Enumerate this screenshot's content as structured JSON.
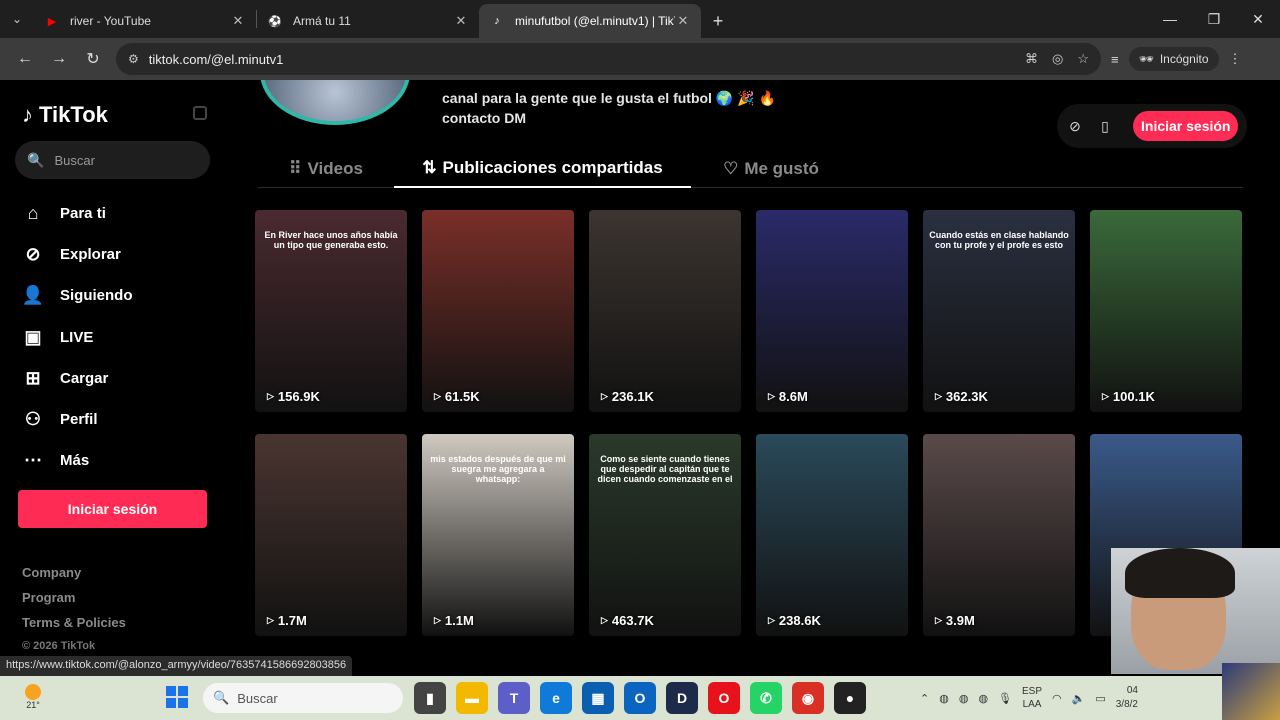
{
  "browser": {
    "tabs": [
      {
        "title": "river - YouTube",
        "favicon": "youtube-icon",
        "active": false
      },
      {
        "title": "Armá tu 11",
        "favicon": "soccer-ball-icon",
        "active": false
      },
      {
        "title": "minufutbol (@el.minutv1) | TikT",
        "favicon": "tiktok-icon",
        "active": true
      }
    ],
    "url": "tiktok.com/@el.minutv1",
    "incognito_label": "Incógnito",
    "status_url": "https://www.tiktok.com/@alonzo_armyy/video/7635741586692803856"
  },
  "sidebar": {
    "logo": "TikTok",
    "search_placeholder": "Buscar",
    "items": [
      {
        "label": "Para ti",
        "icon": "home-icon"
      },
      {
        "label": "Explorar",
        "icon": "compass-icon"
      },
      {
        "label": "Siguiendo",
        "icon": "following-icon"
      },
      {
        "label": "LIVE",
        "icon": "live-icon"
      },
      {
        "label": "Cargar",
        "icon": "upload-icon"
      },
      {
        "label": "Perfil",
        "icon": "profile-icon"
      },
      {
        "label": "Más",
        "icon": "more-icon"
      }
    ],
    "login_button": "Iniciar sesión",
    "footer": [
      "Company",
      "Program",
      "Terms & Policies"
    ],
    "copyright": "© 2026 TikTok"
  },
  "profile": {
    "bio_line1": "canal para la gente que le gusta el futbol 🌍 🎉 🔥",
    "bio_line2": "contacto DM",
    "login_button": "Iniciar sesión",
    "tabs": [
      {
        "label": "Videos",
        "active": false
      },
      {
        "label": "Publicaciones compartidas",
        "active": true
      },
      {
        "label": "Me gustó",
        "active": false
      }
    ]
  },
  "videos": [
    {
      "views": "156.9K",
      "caption": "En River hace unos años había un tipo que generaba esto.",
      "bg": "#4a2a30"
    },
    {
      "views": "61.5K",
      "caption": "",
      "bg": "#7a2f28"
    },
    {
      "views": "236.1K",
      "caption": "",
      "bg": "#3c3530"
    },
    {
      "views": "8.6M",
      "caption": "",
      "bg": "#2a2a6a"
    },
    {
      "views": "362.3K",
      "caption": "Cuando estás en clase hablando con tu profe y el profe es esto",
      "bg": "#2a3040"
    },
    {
      "views": "100.1K",
      "caption": "",
      "bg": "#3a6a3a"
    },
    {
      "views": "1.7M",
      "caption": "",
      "bg": "#4a3530"
    },
    {
      "views": "1.1M",
      "caption": "mis estados después de que mi suegra me agregara a whatsapp:",
      "bg": "#cfc9c0"
    },
    {
      "views": "463.7K",
      "caption": "Como se siente cuando tienes que despedir al capitán que te dicen cuando comenzaste en el",
      "bg": "#2a3a2a"
    },
    {
      "views": "238.6K",
      "caption": "",
      "bg": "#2a4a5a"
    },
    {
      "views": "3.9M",
      "caption": "",
      "bg": "#5a4a4a"
    },
    {
      "views": "",
      "caption": "",
      "bg": "#3a5a8a"
    }
  ],
  "taskbar": {
    "temperature": "21°",
    "search_placeholder": "Buscar",
    "lang_line1": "ESP",
    "lang_line2": "LAA",
    "time": "04",
    "date": "3/8/2"
  },
  "colors": {
    "accent": "#fe2c55",
    "avatar_ring": "#2fb8a6"
  }
}
